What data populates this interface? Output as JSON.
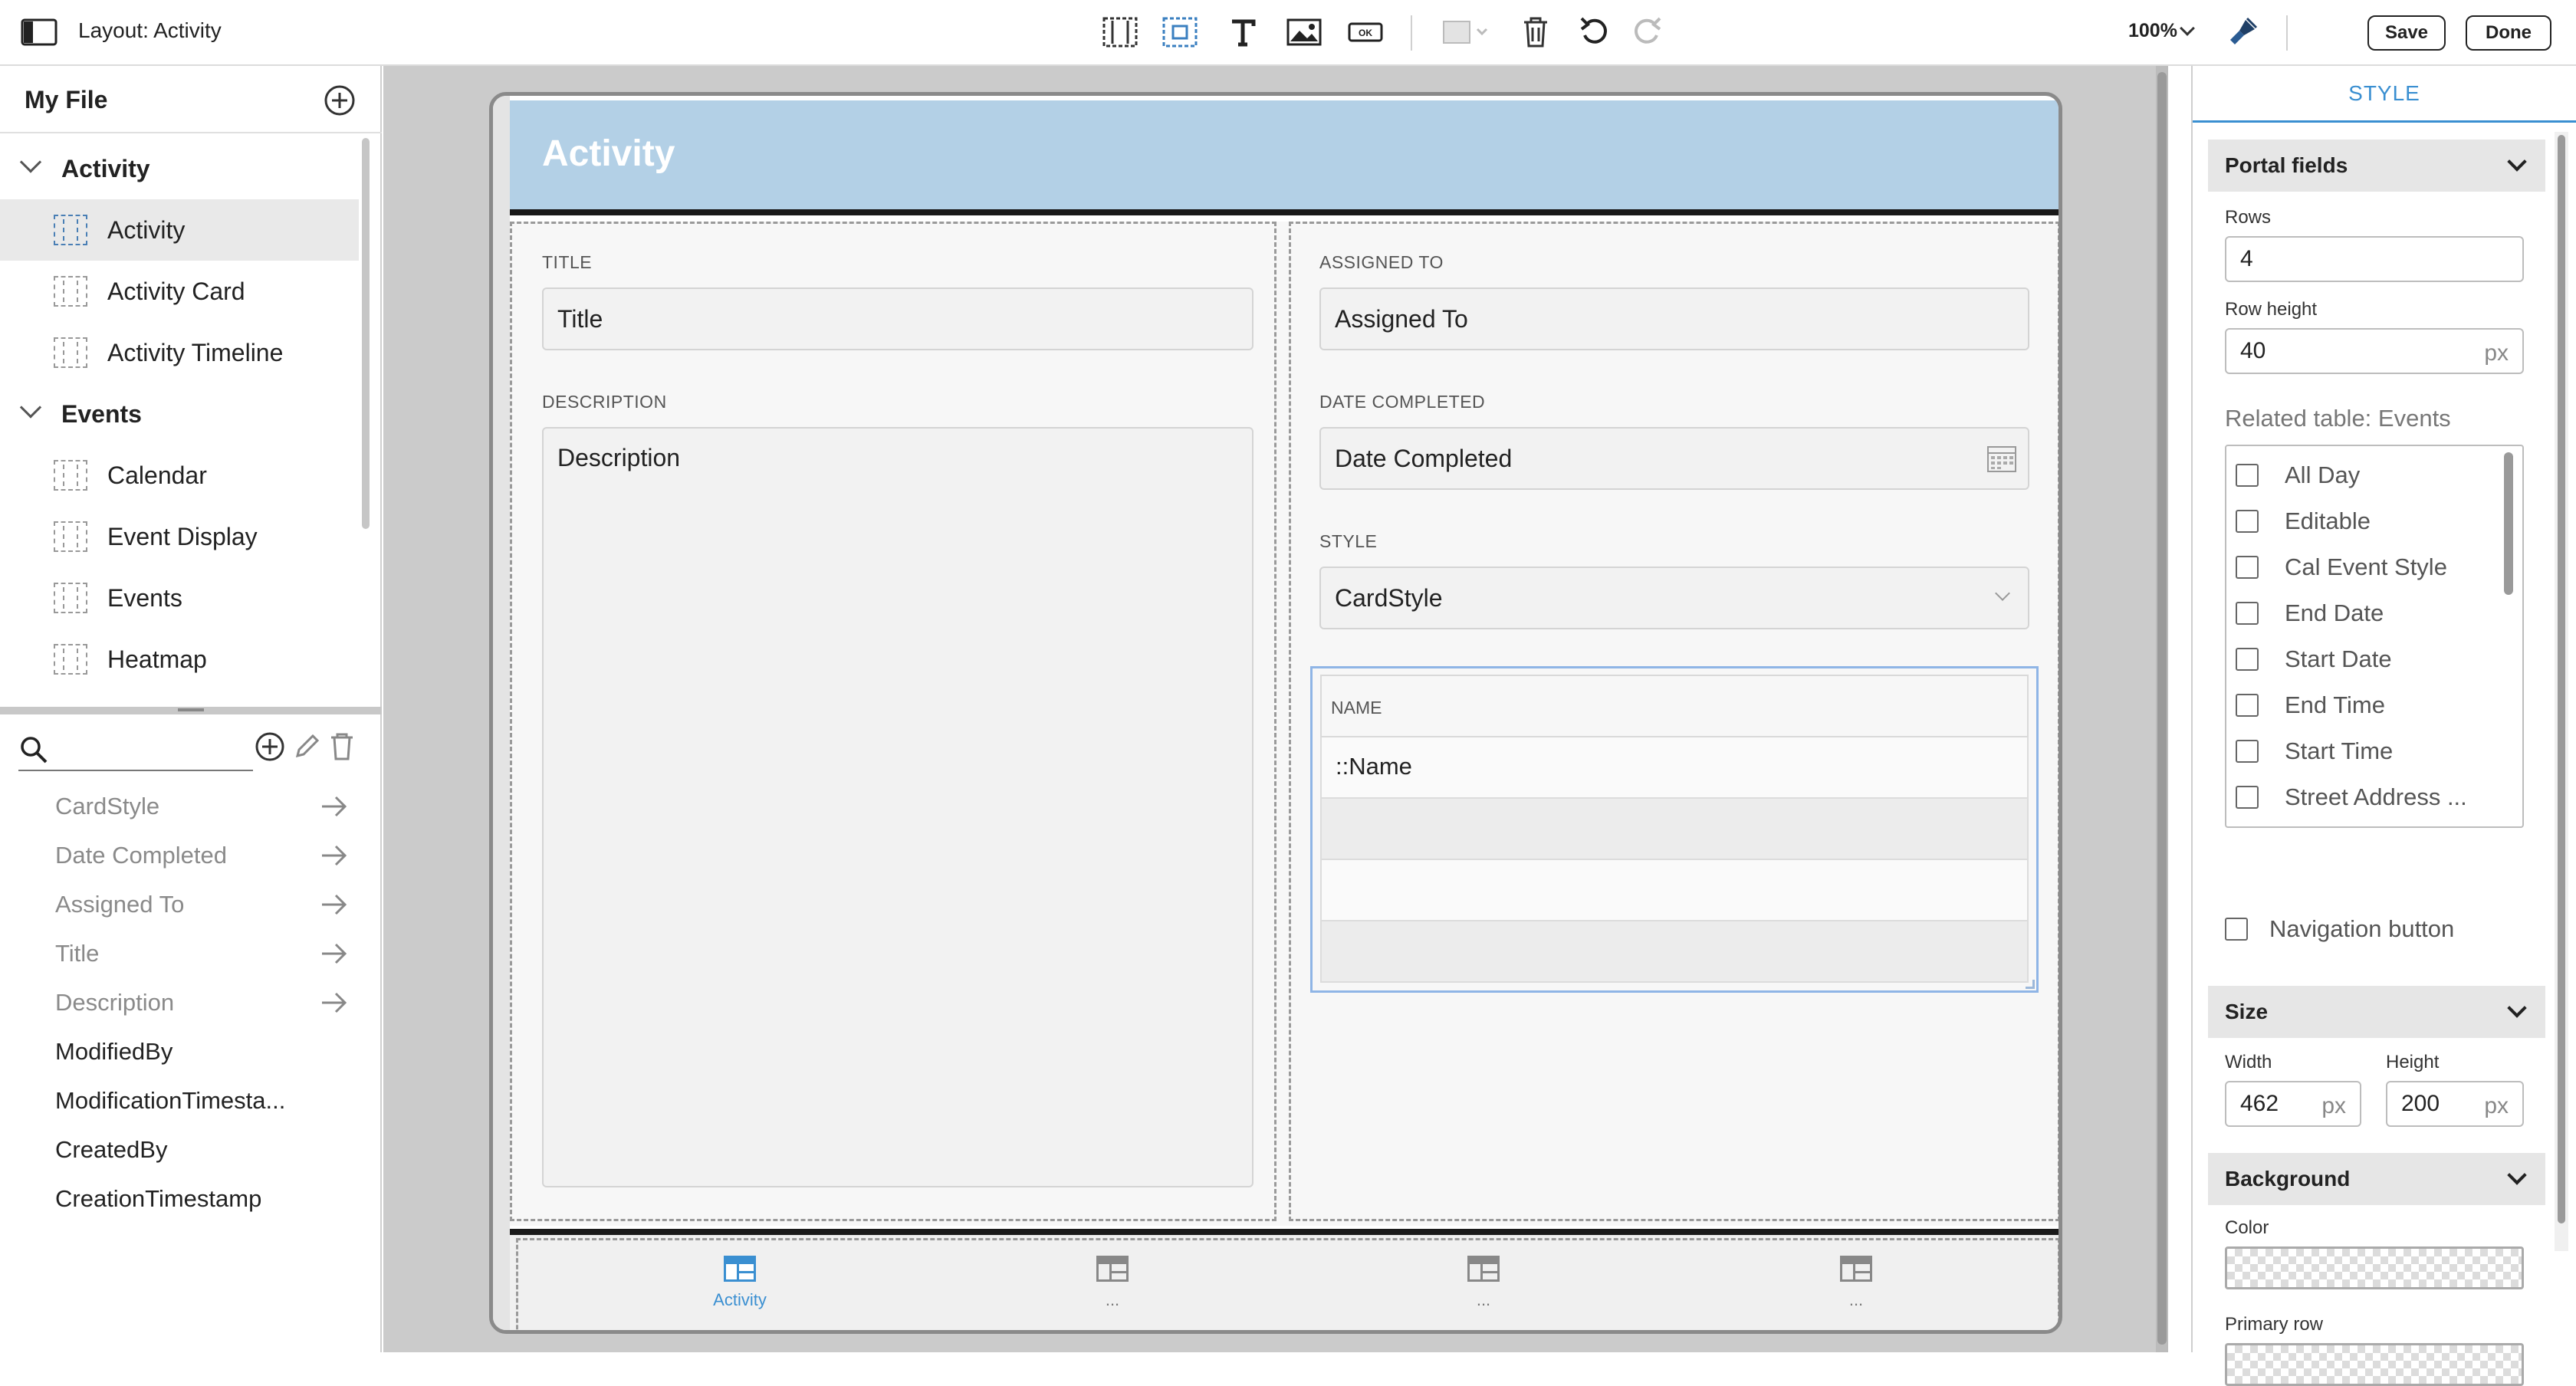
{
  "toolbar": {
    "layout_title": "Layout: Activity",
    "zoom": "100%",
    "save_label": "Save",
    "done_label": "Done",
    "icons": [
      "sidebar-toggle-icon",
      "layout-list-icon",
      "layout-detail-icon",
      "text-tool-icon",
      "image-tool-icon",
      "button-tool-icon",
      "fill-color-icon",
      "trash-icon",
      "undo-icon",
      "redo-icon",
      "theme-brush-icon"
    ]
  },
  "left_panel": {
    "file_title": "My File",
    "groups": [
      {
        "name": "Activity",
        "layouts": [
          "Activity",
          "Activity Card",
          "Activity Timeline"
        ]
      },
      {
        "name": "Events",
        "layouts": [
          "Calendar",
          "Event Display",
          "Events",
          "Heatmap"
        ]
      }
    ],
    "selected_layout": "Activity",
    "fields": [
      {
        "name": "CardStyle",
        "placed": true
      },
      {
        "name": "Date Completed",
        "placed": true
      },
      {
        "name": "Assigned To",
        "placed": true
      },
      {
        "name": "Title",
        "placed": true
      },
      {
        "name": "Description",
        "placed": true
      },
      {
        "name": "ModifiedBy",
        "placed": false
      },
      {
        "name": "ModificationTimesta...",
        "placed": false
      },
      {
        "name": "CreatedBy",
        "placed": false
      },
      {
        "name": "CreationTimestamp",
        "placed": false
      }
    ]
  },
  "device": {
    "header_title": "Activity",
    "left_column": {
      "title_label": "TITLE",
      "title_value": "Title",
      "description_label": "DESCRIPTION",
      "description_value": "Description"
    },
    "right_column": {
      "assigned_label": "ASSIGNED TO",
      "assigned_value": "Assigned To",
      "date_label": "DATE COMPLETED",
      "date_value": "Date Completed",
      "style_label": "STYLE",
      "style_value": "CardStyle",
      "portal_header": "NAME",
      "portal_first_row": "::Name"
    },
    "nav": [
      {
        "label": "Activity",
        "active": true
      },
      {
        "label": "...",
        "active": false
      },
      {
        "label": "...",
        "active": false
      },
      {
        "label": "...",
        "active": false
      }
    ]
  },
  "right_panel": {
    "tab": "STYLE",
    "portal_fields": {
      "header": "Portal fields",
      "rows_label": "Rows",
      "rows_value": "4",
      "row_height_label": "Row height",
      "row_height_value": "40",
      "unit": "px",
      "related_table_label": "Related table: Events",
      "related_fields": [
        {
          "name": "All Day",
          "checked": false
        },
        {
          "name": "Editable",
          "checked": false
        },
        {
          "name": "Cal Event Style",
          "checked": false
        },
        {
          "name": "End Date",
          "checked": false
        },
        {
          "name": "Start Date",
          "checked": false
        },
        {
          "name": "End Time",
          "checked": false
        },
        {
          "name": "Start Time",
          "checked": false
        },
        {
          "name": "Street Address ...",
          "checked": false
        }
      ],
      "navigation_button_label": "Navigation button",
      "navigation_button_checked": false
    },
    "size": {
      "header": "Size",
      "width_label": "Width",
      "width_value": "462",
      "height_label": "Height",
      "height_value": "200",
      "unit": "px"
    },
    "background": {
      "header": "Background",
      "color_label": "Color",
      "primary_row_label": "Primary row"
    }
  },
  "colors": {
    "header_bg": "#b3d0e6",
    "accent": "#3a8fd1",
    "canvas_bg": "#cbcbcb",
    "selection_border": "#8fb5e6"
  }
}
